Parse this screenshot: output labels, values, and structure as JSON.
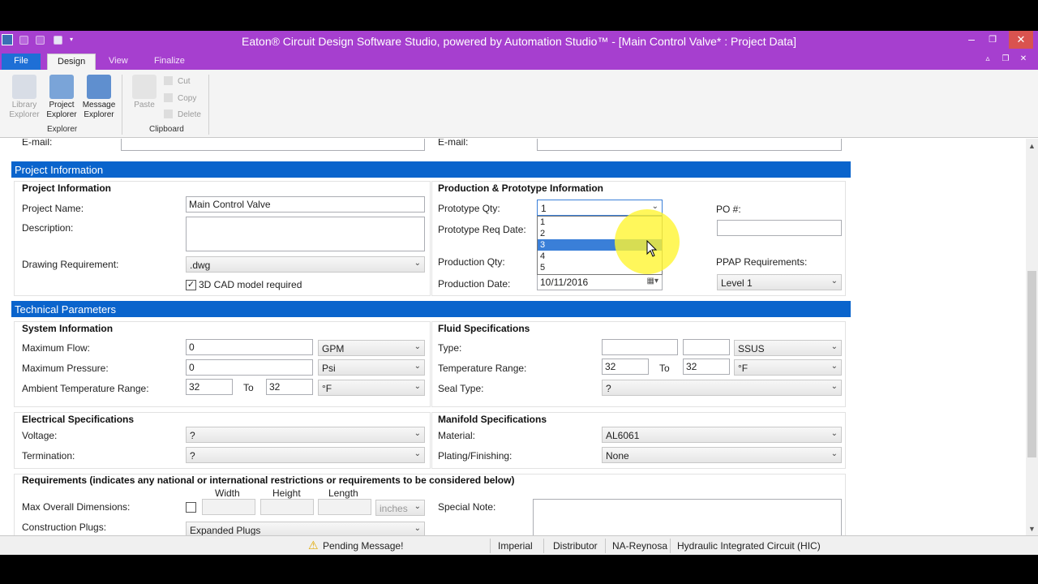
{
  "window": {
    "title": "Eaton® Circuit Design Software Studio, powered by Automation Studio™ - [Main Control Valve* : Project Data]",
    "controls": [
      "–",
      "❐",
      "✕"
    ],
    "inner_controls": [
      "▵",
      "❐",
      "✕"
    ]
  },
  "menu_tabs": [
    "File",
    "Design",
    "View",
    "Finalize"
  ],
  "ribbon": {
    "explorer": {
      "library": "Library Explorer",
      "project": "Project Explorer",
      "message": "Message Explorer",
      "group_label": "Explorer"
    },
    "clipboard": {
      "paste": "Paste",
      "cut": "Cut",
      "copy": "Copy",
      "delete": "Delete",
      "group_label": "Clipboard"
    }
  },
  "email_row": {
    "left_label": "E-mail:",
    "right_label": "E-mail:"
  },
  "project_information": {
    "header": "Project Information",
    "subtitle": "Project Information",
    "project_name_label": "Project Name:",
    "project_name_value": "Main Control Valve",
    "description_label": "Description:",
    "drawing_label": "Drawing Requirement:",
    "drawing_value": ".dwg",
    "cad_label": "3D CAD model required",
    "cad_checked": "✓"
  },
  "production": {
    "subtitle": "Production & Prototype Information",
    "prototype_qty_label": "Prototype Qty:",
    "prototype_qty_value": "1",
    "prototype_req_label": "Prototype Req Date:",
    "production_qty_label": "Production Qty:",
    "production_date_label": "Production Date:",
    "production_date_value": "10/11/2016",
    "po_label": "PO #:",
    "ppap_label": "PPAP Requirements:",
    "ppap_value": "Level 1",
    "dropdown_options": [
      "1",
      "2",
      "3",
      "4",
      "5"
    ],
    "dropdown_highlighted": "3"
  },
  "technical": {
    "header": "Technical Parameters",
    "system": {
      "subtitle": "System Information",
      "max_flow_label": "Maximum Flow:",
      "max_flow_value": "0",
      "max_flow_unit": "GPM",
      "max_pressure_label": "Maximum Pressure:",
      "max_pressure_value": "0",
      "max_pressure_unit": "Psi",
      "ambient_label": "Ambient Temperature Range:",
      "ambient_from": "32",
      "to": "To",
      "ambient_to": "32",
      "ambient_unit": "°F"
    },
    "fluid": {
      "subtitle": "Fluid Specifications",
      "type_label": "Type:",
      "type_unit": "SSUS",
      "temp_label": "Temperature Range:",
      "temp_from": "32",
      "to": "To",
      "temp_to": "32",
      "temp_unit": "°F",
      "seal_label": "Seal Type:",
      "seal_value": "?"
    },
    "electrical": {
      "subtitle": "Electrical Specifications",
      "voltage_label": "Voltage:",
      "voltage_value": "?",
      "termination_label": "Termination:",
      "termination_value": "?"
    },
    "manifold": {
      "subtitle": "Manifold Specifications",
      "material_label": "Material:",
      "material_value": "AL6061",
      "plating_label": "Plating/Finishing:",
      "plating_value": "None"
    }
  },
  "requirements": {
    "subtitle": "Requirements (indicates any national or international restrictions or requirements to be considered below)",
    "width": "Width",
    "height": "Height",
    "length": "Length",
    "max_dims_label": "Max Overall Dimensions:",
    "units": "inches",
    "special_note_label": "Special Note:",
    "plugs_label": "Construction Plugs:",
    "plugs_value": "Expanded Plugs"
  },
  "status": {
    "pending": "Pending Message!",
    "system": "Imperial",
    "role": "Distributor",
    "region": "NA-Reynosa",
    "mode": "Hydraulic Integrated Circuit (HIC)"
  },
  "colors": {
    "title_bar": "#a63fcf",
    "section_header": "#0a64cc",
    "file_tab": "#1e6fd6",
    "highlight": "#fff532"
  }
}
